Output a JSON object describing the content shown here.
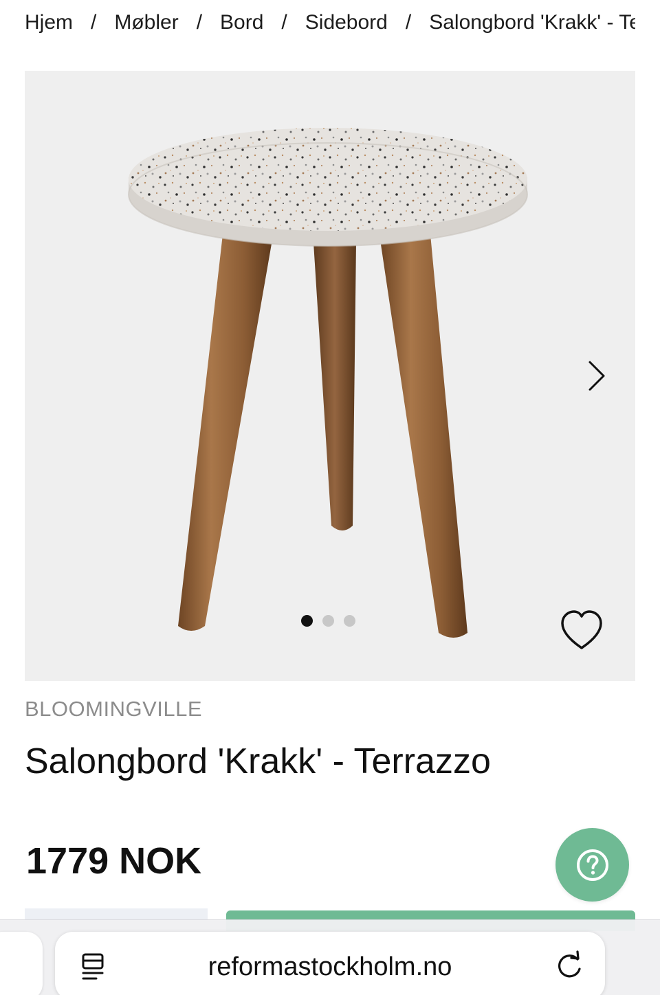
{
  "breadcrumb": {
    "items": [
      "Hjem",
      "Møbler",
      "Bord",
      "Sidebord",
      "Salongbord 'Krakk' - Terrazzo"
    ],
    "separator": "/"
  },
  "gallery": {
    "image_count": 3,
    "active_index": 0,
    "next_icon": "chevron-right-icon",
    "favorite_icon": "heart-outline-icon"
  },
  "product": {
    "brand": "BLOOMINGVILLE",
    "title": "Salongbord 'Krakk' - Terrazzo",
    "price": "1779 NOK"
  },
  "help": {
    "icon": "question-circle-icon"
  },
  "browser": {
    "url": "reformastockholm.no",
    "reader_icon": "reader-icon",
    "reload_icon": "reload-icon"
  },
  "colors": {
    "accent_green": "#6fba94",
    "gallery_bg": "#efefef",
    "brand_text": "#8c8c8c"
  }
}
